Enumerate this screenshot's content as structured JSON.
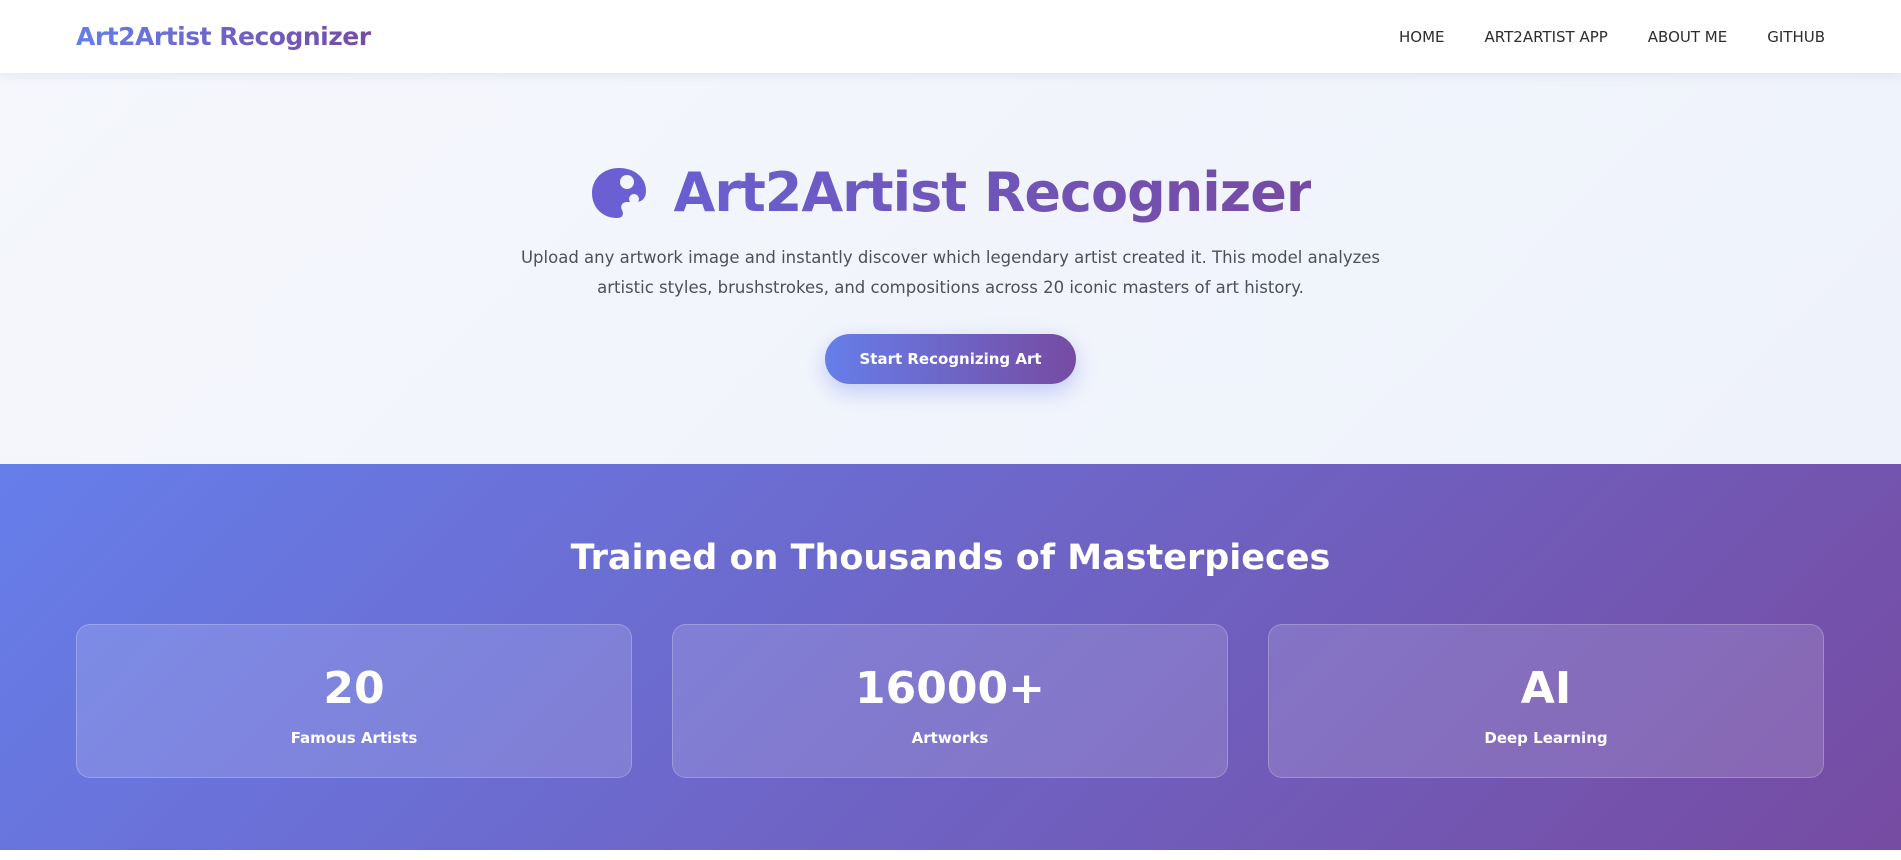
{
  "nav": {
    "brand": "Art2Artist Recognizer",
    "links": [
      "HOME",
      "ART2ARTIST APP",
      "ABOUT ME",
      "GITHUB"
    ]
  },
  "hero": {
    "icon": "palette-icon",
    "title": "Art2Artist Recognizer",
    "description": "Upload any artwork image and instantly discover which legendary artist created it. This model analyzes artistic styles, brushstrokes, and compositions across 20 iconic masters of art history.",
    "cta_label": "Start Recognizing Art"
  },
  "stats": {
    "heading": "Trained on Thousands of Masterpieces",
    "cards": [
      {
        "value": "20",
        "label": "Famous Artists"
      },
      {
        "value": "16000+",
        "label": "Artworks"
      },
      {
        "value": "AI",
        "label": "Deep Learning"
      }
    ]
  },
  "colors": {
    "gradient_start": "#667eea",
    "gradient_end": "#764ba2",
    "hero_bg": "#f2f5fc",
    "nav_text": "#2d2d2d"
  }
}
